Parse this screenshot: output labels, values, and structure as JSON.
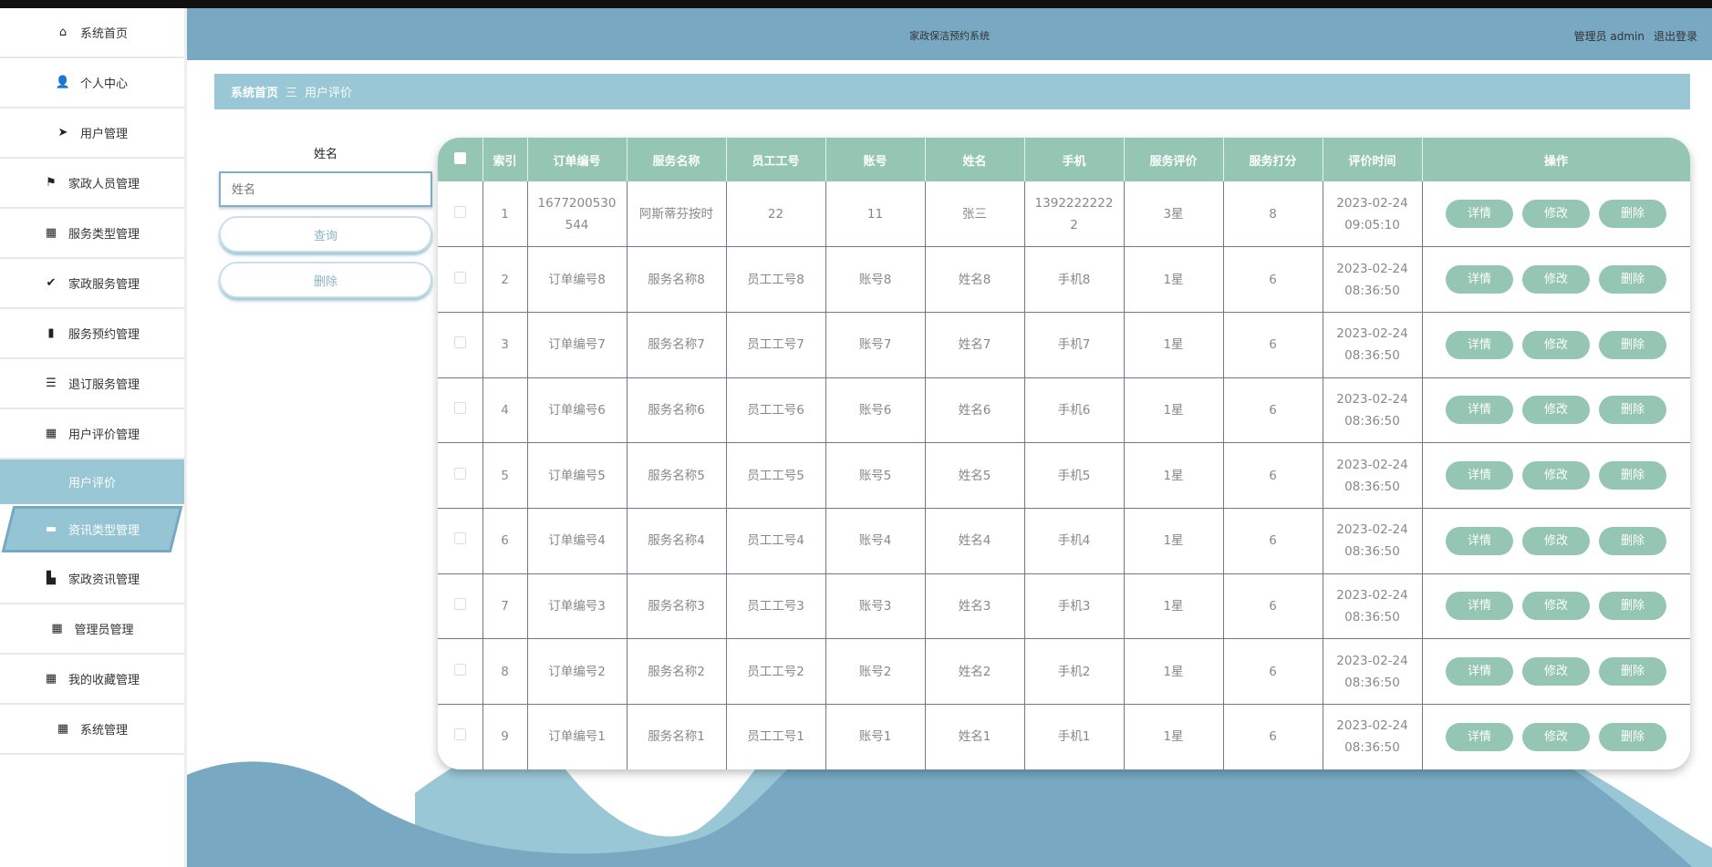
{
  "header": {
    "title": "家政保洁预约系统",
    "user": "管理员 admin",
    "logout": "退出登录"
  },
  "sidebar": {
    "items": [
      {
        "label": "系统首页",
        "icon": "home-icon",
        "glyph": "⌂"
      },
      {
        "label": "个人中心",
        "icon": "user-icon",
        "glyph": "👤"
      },
      {
        "label": "用户管理",
        "icon": "paper-plane-icon",
        "glyph": "➤"
      },
      {
        "label": "家政人员管理",
        "icon": "flag-icon",
        "glyph": "⚑"
      },
      {
        "label": "服务类型管理",
        "icon": "grid-icon",
        "glyph": "▦"
      },
      {
        "label": "家政服务管理",
        "icon": "clipboard-check-icon",
        "glyph": "✔"
      },
      {
        "label": "服务预约管理",
        "icon": "bar-chart-icon",
        "glyph": "▮"
      },
      {
        "label": "退订服务管理",
        "icon": "list-icon",
        "glyph": "☰"
      },
      {
        "label": "用户评价管理",
        "icon": "grid-nine-icon",
        "glyph": "▦"
      },
      {
        "label": "用户评价"
      },
      {
        "label": "资讯类型管理",
        "icon": "comment-icon",
        "glyph": "▬"
      },
      {
        "label": "家政资讯管理",
        "icon": "book-icon",
        "glyph": "▙"
      },
      {
        "label": "管理员管理",
        "icon": "grid-icon",
        "glyph": "▦"
      },
      {
        "label": "我的收藏管理",
        "icon": "grid-icon",
        "glyph": "▦"
      },
      {
        "label": "系统管理",
        "icon": "grid-icon",
        "glyph": "▦"
      }
    ]
  },
  "breadcrumb": {
    "home": "系统首页",
    "sep": "三",
    "current": "用户评价"
  },
  "search": {
    "label": "姓名",
    "placeholder": "姓名",
    "query": "查询",
    "delete": "删除"
  },
  "table": {
    "headers": [
      "索引",
      "订单编号",
      "服务名称",
      "员工工号",
      "账号",
      "姓名",
      "手机",
      "服务评价",
      "服务打分",
      "评价时间",
      "操作"
    ],
    "actions": [
      "详情",
      "修改",
      "删除"
    ],
    "rows": [
      [
        "1",
        "1677200530544",
        "阿斯蒂芬按时",
        "22",
        "11",
        "张三",
        "13922222222",
        "3星",
        "8",
        "2023-02-24 09:05:10"
      ],
      [
        "2",
        "订单编号8",
        "服务名称8",
        "员工工号8",
        "账号8",
        "姓名8",
        "手机8",
        "1星",
        "6",
        "2023-02-24 08:36:50"
      ],
      [
        "3",
        "订单编号7",
        "服务名称7",
        "员工工号7",
        "账号7",
        "姓名7",
        "手机7",
        "1星",
        "6",
        "2023-02-24 08:36:50"
      ],
      [
        "4",
        "订单编号6",
        "服务名称6",
        "员工工号6",
        "账号6",
        "姓名6",
        "手机6",
        "1星",
        "6",
        "2023-02-24 08:36:50"
      ],
      [
        "5",
        "订单编号5",
        "服务名称5",
        "员工工号5",
        "账号5",
        "姓名5",
        "手机5",
        "1星",
        "6",
        "2023-02-24 08:36:50"
      ],
      [
        "6",
        "订单编号4",
        "服务名称4",
        "员工工号4",
        "账号4",
        "姓名4",
        "手机4",
        "1星",
        "6",
        "2023-02-24 08:36:50"
      ],
      [
        "7",
        "订单编号3",
        "服务名称3",
        "员工工号3",
        "账号3",
        "姓名3",
        "手机3",
        "1星",
        "6",
        "2023-02-24 08:36:50"
      ],
      [
        "8",
        "订单编号2",
        "服务名称2",
        "员工工号2",
        "账号2",
        "姓名2",
        "手机2",
        "1星",
        "6",
        "2023-02-24 08:36:50"
      ],
      [
        "9",
        "订单编号1",
        "服务名称1",
        "员工工号1",
        "账号1",
        "姓名1",
        "手机1",
        "1星",
        "6",
        "2023-02-24 08:36:50"
      ]
    ]
  },
  "colors": {
    "header": "#78a8c2",
    "accent": "#99c7d6",
    "table_header": "#95c6b4"
  }
}
